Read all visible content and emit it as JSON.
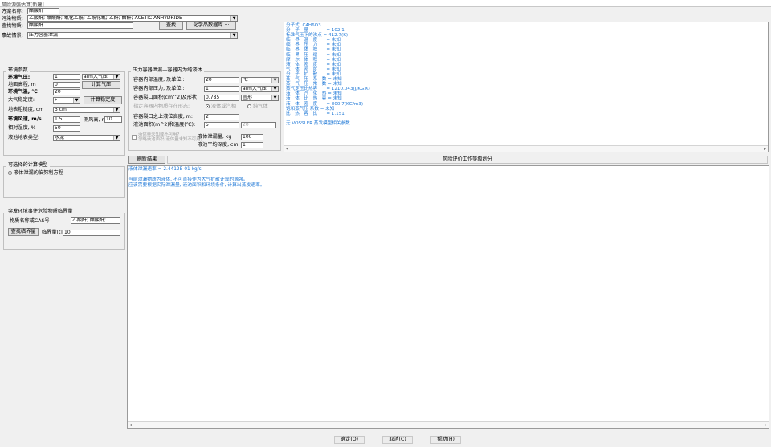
{
  "window": {
    "title": "风险源强估算[新建]"
  },
  "top": {
    "scheme_label": "方案名称:",
    "scheme_value": "醋酸酐",
    "pollutant_label": "污染物质:",
    "pollutant_value": "乙酸酐; 醋酸酐; 氧化乙酰; 乙酰化氧; 乙酐; 醋酐; ACETIC ANHYDRIDE",
    "query_label": "查找物质:",
    "query_value": "醋酸酐",
    "find_btn": "查找",
    "db_btn": "化学品数据库 ···",
    "scenario_label": "事故情景:",
    "scenario_value": "压力容器泄漏"
  },
  "env": {
    "title": "环境参数",
    "pressure_label": "环境气压:",
    "pressure_value": "1",
    "pressure_unit": "atm大气压",
    "altitude_label": "地面高程, m",
    "altitude_value": "0",
    "calc_btn": "计算气压",
    "temp_label": "环境气温, ℃",
    "temp_value": "20",
    "stability_label": "大气稳定度:",
    "stability_value": "F",
    "stability_btn": "计算稳定度",
    "roughness_label": "地表粗糙度, cm",
    "roughness_value": "3 cm",
    "wind_label": "环境风速, m/s",
    "wind_value": "1.5",
    "windh_label": "测风高, m",
    "windh_value": "10",
    "humidity_label": "相对湿度, %",
    "humidity_value": "50",
    "ground_label": "液池地表类型:",
    "ground_value": "水泥"
  },
  "vessel": {
    "title": "压力容器泄漏—容器内为纯液体",
    "temp_label": "容器内部温度, 及单位 :",
    "temp_value": "20",
    "temp_unit": "℃",
    "press_label": "容器内部压力, 及单位 :",
    "press_value": "1",
    "press_unit": "atm大气压",
    "area_label": "容器裂口面积(cm^2)及形状",
    "area_value": "0.785",
    "shape_value": "圆形",
    "state_label": "指定容器内物质存在形态:",
    "state_opt1": "液体或汽相",
    "state_opt2": "纯气体",
    "height_label": "容器裂口之上液位高度, m:",
    "height_value": "2",
    "pool_label": "液池面积(m^2)和温度(℃):",
    "pool_area": "5",
    "pool_temp": "20",
    "chk_label1": "液体量未知或不可用?",
    "chk_label2": "忽略液池面积(液体量未知不可用)",
    "mass_label": "液体泄漏量, kg",
    "mass_value": "100",
    "depth_label": "液池平均深度, cm",
    "depth_value": "1"
  },
  "props": [
    "分子式: C4H6O3",
    "分　子　量　　　　= 102.1",
    "标准气压下的沸点 = 412.7(K)",
    "临　界　温　度　　= 未知",
    "临　界　压　力　　= 未知",
    "临　界　体　积　　= 未知",
    "临　界　压　缩　　= 未知",
    "摩　尔　体　积　　= 未知",
    "液　体　密　度　　= 未知",
    "气　体　密　度　　= 未知",
    "分　子　扩　散　　= 未知",
    "蒸　气　压　系　数 = 未知",
    "蒸　气　压　常　数 = 未知",
    "蒸气定压比热容　　= 1210.043(J/KG.K)",
    "液　体　汽　化　热 = 未知",
    "液　体　比　热　容 = 未知",
    "液　体　密　度　　= 800.7(KG/m3)",
    "饱和蒸气压 系数 = 未知",
    "比　热　容　比　　= 1.151",
    "",
    "无 VOSSLER 蒸发模型相关参数"
  ],
  "tabs": {
    "refresh": "刷新结果",
    "risk": "风险评价工作等级划分"
  },
  "results": [
    "液体泄漏速率 = 2.4412E-01 kg/s",
    "",
    "当前泄漏物质为液体, 不可直接作为大气扩散计算的源强。",
    "应该需要根据实际泄漏量, 液池面积和环境条件, 计算出蒸发速率。"
  ],
  "model": {
    "title": "可选择的计算模型",
    "option": "液体泄漏的伯努利方程"
  },
  "sudden": {
    "title": "突发环境事件危险物质临界量",
    "name_label": "物质名称或CAS号",
    "name_value": "乙酸酐; 醋酸酐;",
    "btn": "查找临界量",
    "qty_label": "临界量[t]:",
    "qty_value": "10"
  },
  "footer": {
    "ok": "确定(O)",
    "cancel": "取消(C)",
    "help": "帮助(H)"
  }
}
